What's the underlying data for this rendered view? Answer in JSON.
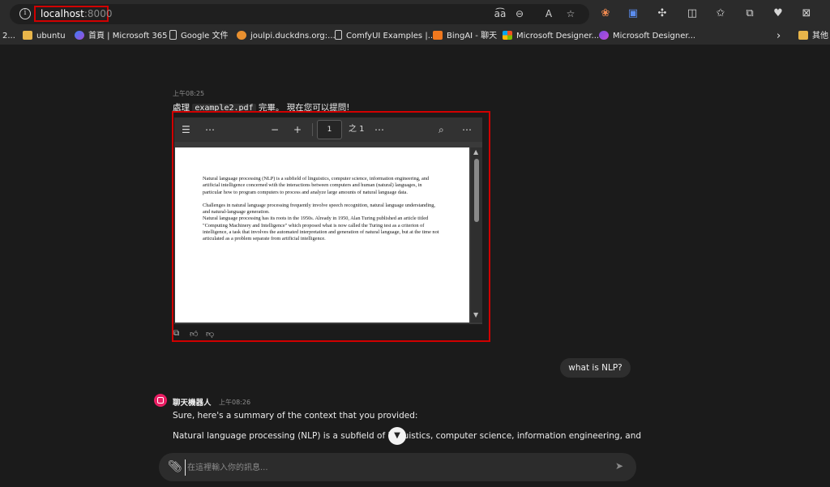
{
  "browser": {
    "url_host": "localhost",
    "url_port": ":8000",
    "address_icons": [
      "read-aloud-icon",
      "zoom-out-icon",
      "immersive-reader-icon",
      "favorite-star-icon"
    ],
    "toolbar_icons": [
      "extension-icon",
      "translate-icon",
      "puzzle-icon",
      "split-screen-icon",
      "favorites-icon",
      "collections-icon",
      "heart-icon",
      "screenshot-icon"
    ]
  },
  "bookmarks": {
    "items": [
      {
        "label": "2...",
        "icon": "none"
      },
      {
        "label": "ubuntu",
        "icon": "folder"
      },
      {
        "label": "首頁 | Microsoft 365",
        "icon": "m365"
      },
      {
        "label": "Google 文件",
        "icon": "doc"
      },
      {
        "label": "joulpi.duckdns.org:...",
        "icon": "orange"
      },
      {
        "label": "ComfyUI Examples |...",
        "icon": "doc"
      },
      {
        "label": "BingAI - 聊天",
        "icon": "bing"
      },
      {
        "label": "Microsoft Designer...",
        "icon": "ms"
      },
      {
        "label": "Microsoft Designer...",
        "icon": "designer"
      }
    ],
    "more": "›",
    "other": "其他"
  },
  "message_upload": {
    "time": "上午08:25",
    "text_before": "處理 ",
    "filename": "example2.pdf",
    "text_after": " 完畢。 現在您可以提問!"
  },
  "pdf_viewer": {
    "page": "1",
    "page_total": "之 1",
    "paragraph1": "Natural language processing (NLP) is a subfield of linguistics, computer science, information engineering, and artificial intelligence concerned with the interactions between computers and human (natural) languages, in particular how to program computers to process and analyze large amounts of natural language data.",
    "paragraph2": "Challenges in natural language processing frequently involve speech recognition, natural language understanding, and natural-language generation.",
    "paragraph3": "Natural language processing has its roots in the 1950s. Already in 1950, Alan Turing published an article titled \"Computing Machinery and Intelligence\" which proposed what is now called the Turing test as a criterion of intelligence, a task that involves the automated interpretation and generation of natural language, but at the time not articulated as a problem separate from artificial intelligence."
  },
  "user_message": "what is NLP?",
  "bot": {
    "name": "聊天機器人",
    "time": "上午08:26",
    "line1": "Sure, here's a summary of the context that you provided:",
    "line2": "Natural language processing (NLP) is a subfield of linguistics, computer science, information engineering, and"
  },
  "composer": {
    "placeholder": "在這裡輸入你的訊息..."
  },
  "colors": {
    "highlight": "#d10000",
    "bot_avatar": "#e91e63"
  }
}
